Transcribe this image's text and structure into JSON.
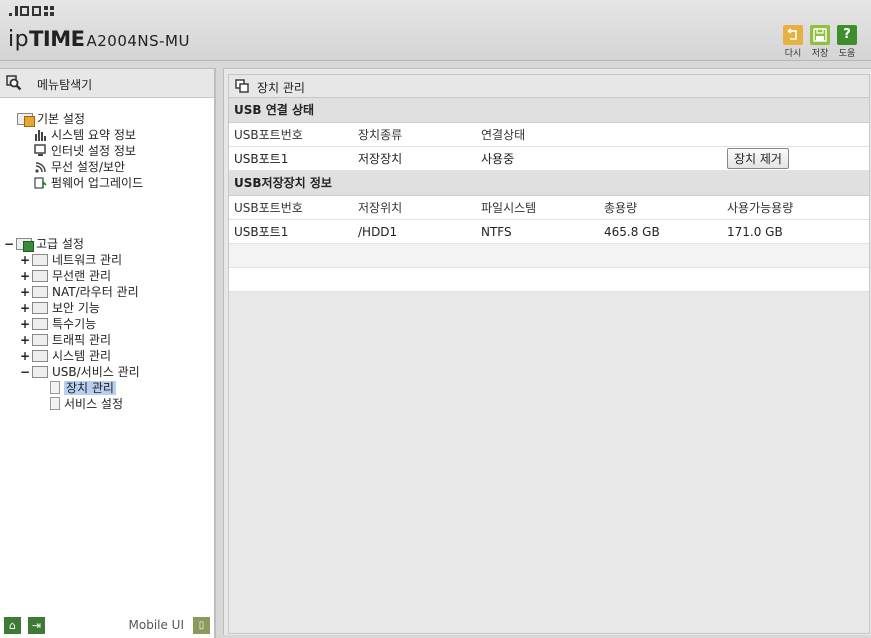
{
  "header": {
    "brand_ip": "ip",
    "brand_time": "TIME",
    "model": "A2004NS-MU",
    "buttons": [
      {
        "label": "다시",
        "icon": "undo-icon",
        "color": "#e8b040"
      },
      {
        "label": "저장",
        "icon": "save-icon",
        "color": "#8fbf3f"
      },
      {
        "label": "도움",
        "icon": "help-icon",
        "color": "#3e8e2e"
      }
    ]
  },
  "sidebar": {
    "title": "메뉴탐색기",
    "basic": {
      "label": "기본 설정",
      "items": [
        "시스템 요약 정보",
        "인터넷 설정 정보",
        "무선 설정/보안",
        "펌웨어 업그레이드"
      ]
    },
    "advanced": {
      "label": "고급 설정",
      "items": [
        "네트워크 관리",
        "무선랜 관리",
        "NAT/라우터 관리",
        "보안 기능",
        "특수기능",
        "트래픽 관리",
        "시스템 관리",
        "USB/서비스 관리"
      ],
      "usb_children": [
        "장치 관리",
        "서비스 설정"
      ]
    },
    "footer": {
      "mobile_label": "Mobile UI"
    }
  },
  "main": {
    "title": "장치 관리",
    "usb_status": {
      "title": "USB 연결 상태",
      "headers": [
        "USB포트번호",
        "장치종류",
        "연결상태"
      ],
      "rows": [
        [
          "USB포트1",
          "저장장치",
          "사용중"
        ]
      ],
      "remove_button": "장치 제거"
    },
    "storage_info": {
      "title": "USB저장장치 정보",
      "headers": [
        "USB포트번호",
        "저장위치",
        "파일시스템",
        "총용량",
        "사용가능용량"
      ],
      "rows": [
        [
          "USB포트1",
          "/HDD1",
          "NTFS",
          "465.8 GB",
          "171.0 GB"
        ]
      ]
    }
  },
  "colors": {
    "selected": "#b9cff0",
    "green": "#3d7a34"
  }
}
